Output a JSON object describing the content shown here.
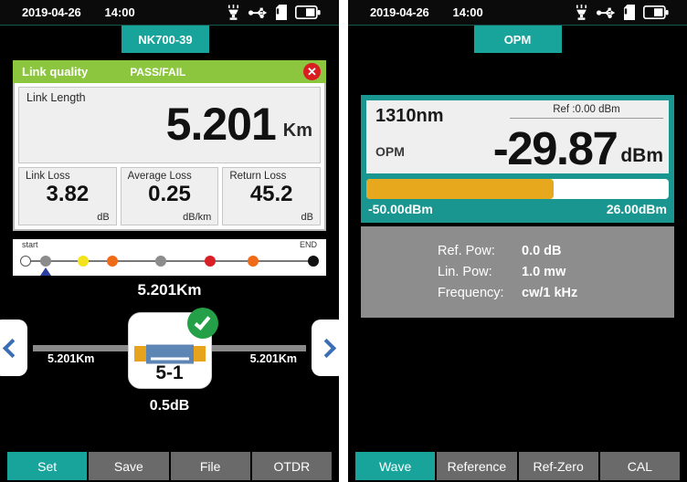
{
  "left": {
    "statusbar": {
      "date": "2019-04-26",
      "time": "14:00",
      "icons": [
        "laser-source-icon",
        "usb-icon",
        "sd-card-icon",
        "battery-icon"
      ]
    },
    "tab": {
      "label": "NK700-39"
    },
    "link_quality": {
      "title": "Link quality",
      "result": "PASS/FAIL",
      "close_label": "✕",
      "header_color": "#8cc63f",
      "close_color": "#d91d20"
    },
    "metrics": {
      "main": {
        "label": "Link Length",
        "value": "5.201",
        "unit": "Km"
      },
      "cells": [
        {
          "label": "Link Loss",
          "value": "3.82",
          "unit": "dB"
        },
        {
          "label": "Average Loss",
          "value": "0.25",
          "unit": "dB/km"
        },
        {
          "label": "Return Loss",
          "value": "45.2",
          "unit": "dB"
        }
      ]
    },
    "event_map": {
      "start_label": "start",
      "end_label": "END",
      "total_label": "5.201Km",
      "marker_position_pct": 7,
      "events": [
        {
          "pos_pct": 0,
          "color": "#ffffff"
        },
        {
          "pos_pct": 7,
          "color": "#8c8c8c"
        },
        {
          "pos_pct": 20,
          "color": "#f2e31c"
        },
        {
          "pos_pct": 30,
          "color": "#ef6b18"
        },
        {
          "pos_pct": 47,
          "color": "#8c8c8c"
        },
        {
          "pos_pct": 64,
          "color": "#d81f26"
        },
        {
          "pos_pct": 79,
          "color": "#ef6b18"
        },
        {
          "pos_pct": 100,
          "color": "#111111"
        }
      ]
    },
    "event_detail": {
      "prev_label": "‹",
      "next_label": "›",
      "left_distance": "5.201Km",
      "right_distance": "5.201Km",
      "event_id": "5-1",
      "loss": "0.5dB",
      "status": "pass"
    },
    "toolbar": {
      "buttons": [
        {
          "label": "Set",
          "active": true
        },
        {
          "label": "Save",
          "active": false
        },
        {
          "label": "File",
          "active": false
        },
        {
          "label": "OTDR",
          "active": false
        }
      ]
    }
  },
  "right": {
    "statusbar": {
      "date": "2019-04-26",
      "time": "14:00",
      "icons": [
        "laser-source-icon",
        "usb-icon",
        "sd-card-icon",
        "battery-icon"
      ]
    },
    "tab": {
      "label": "OPM"
    },
    "opm": {
      "wavelength": "1310nm",
      "reference": "Ref :0.00  dBm",
      "mode": "OPM",
      "value": "-29.87",
      "unit": "dBm",
      "bar_fill_pct": 62,
      "bar_color": "#e8a81d",
      "scale_min": "-50.00dBm",
      "scale_max": "26.00dBm"
    },
    "info": [
      {
        "key": "Ref. Pow:",
        "value": "0.0 dB"
      },
      {
        "key": "Lin. Pow:",
        "value": "1.0 mw"
      },
      {
        "key": "Frequency:",
        "value": "cw/1 kHz"
      }
    ],
    "toolbar": {
      "buttons": [
        {
          "label": "Wave",
          "active": true
        },
        {
          "label": "Reference",
          "active": false
        },
        {
          "label": "Ref-Zero",
          "active": false
        },
        {
          "label": "CAL",
          "active": false
        }
      ]
    }
  }
}
